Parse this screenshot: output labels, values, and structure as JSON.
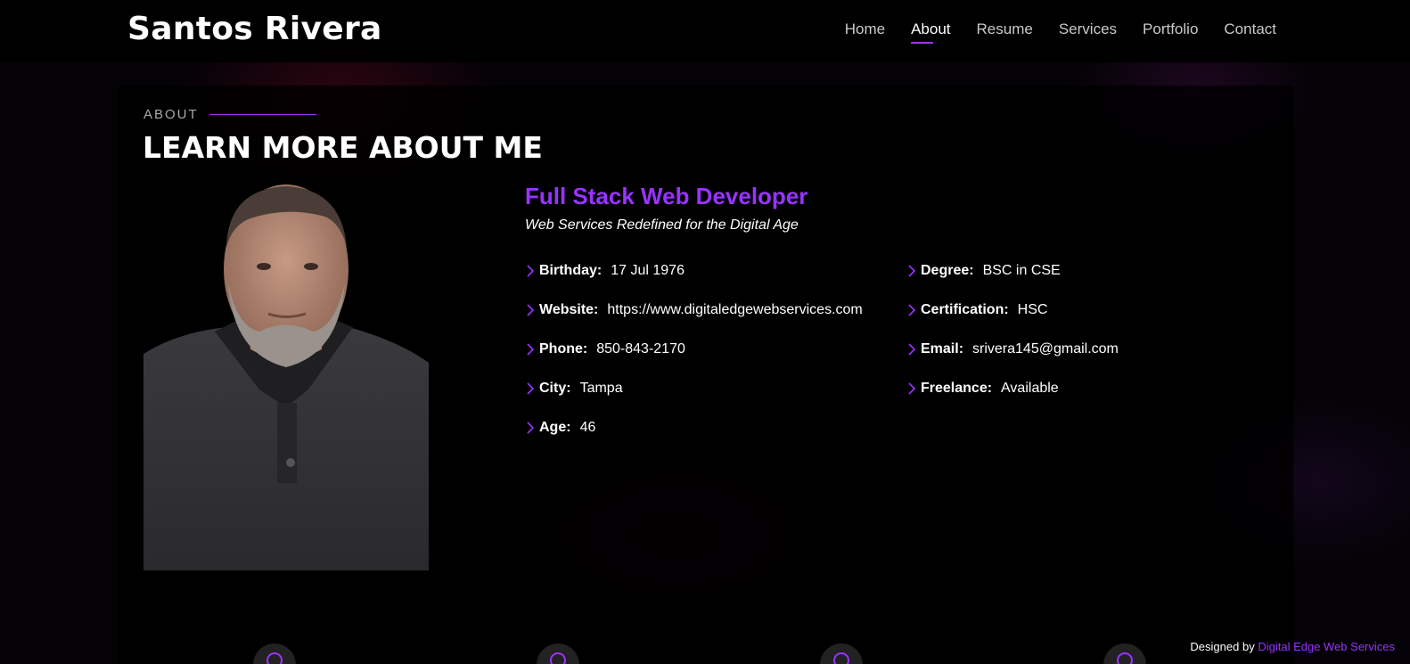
{
  "header": {
    "logo": "Santos Rivera",
    "nav": [
      {
        "label": "Home"
      },
      {
        "label": "About",
        "active": true
      },
      {
        "label": "Resume"
      },
      {
        "label": "Services"
      },
      {
        "label": "Portfolio"
      },
      {
        "label": "Contact"
      }
    ]
  },
  "about": {
    "section_label": "ABOUT",
    "title": "LEARN MORE ABOUT ME",
    "role": "Full Stack Web Developer",
    "tagline": "Web Services Redefined for the Digital Age",
    "left": [
      {
        "key": "Birthday:",
        "value": "17 Jul 1976"
      },
      {
        "key": "Website:",
        "value": "https://www.digitaledgewebservices.com"
      },
      {
        "key": "Phone:",
        "value": "850-843-2170"
      },
      {
        "key": "City:",
        "value": "Tampa"
      },
      {
        "key": "Age:",
        "value": "46"
      }
    ],
    "right": [
      {
        "key": "Degree:",
        "value": "BSC in CSE"
      },
      {
        "key": "Certification:",
        "value": "HSC"
      },
      {
        "key": "Email:",
        "value": "srivera145@gmail.com"
      },
      {
        "key": "Freelance:",
        "value": "Available"
      }
    ]
  },
  "footer": {
    "credit_prefix": "Designed by",
    "credit_link": "Digital Edge Web Services"
  },
  "colors": {
    "accent": "#9933ff",
    "background": "#040206"
  },
  "icons": {
    "list_bullet": "chevron-right-icon"
  }
}
